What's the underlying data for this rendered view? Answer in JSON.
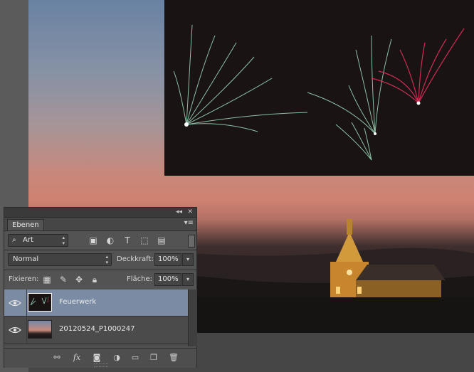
{
  "panel": {
    "tab_label": "Ebenen",
    "collapse_glyph": "◂◂",
    "close_glyph": "✕",
    "menu_glyph": "▾≡"
  },
  "filter": {
    "kind_label": "Art",
    "icons": [
      "search-icon",
      "image-filter-icon",
      "adjustment-filter-icon",
      "type-filter-icon",
      "shape-filter-icon",
      "smart-object-filter-icon"
    ]
  },
  "blend": {
    "mode": "Normal",
    "opacity_label": "Deckkraft:",
    "opacity_value": "100%"
  },
  "lock": {
    "label": "Fixieren:",
    "fill_label": "Fläche:",
    "fill_value": "100%",
    "icons": [
      "lock-transparent-icon",
      "lock-brush-icon",
      "lock-move-icon",
      "lock-all-icon"
    ]
  },
  "layers": [
    {
      "name": "Feuerwerk",
      "selected": true,
      "visible": true
    },
    {
      "name": "20120524_P1000247",
      "selected": false,
      "visible": true
    }
  ],
  "bottom_icons": [
    "link-icon",
    "fx-icon",
    "mask-icon",
    "adjustment-layer-icon",
    "group-folder-icon",
    "new-layer-icon",
    "trash-icon"
  ],
  "bottom_fx_label": "fx",
  "colors": {
    "panel_bg": "#535353",
    "selected_row": "#7a8ba3",
    "fireworks_red": "#e0305a",
    "fireworks_green": "#9fe0c0"
  }
}
